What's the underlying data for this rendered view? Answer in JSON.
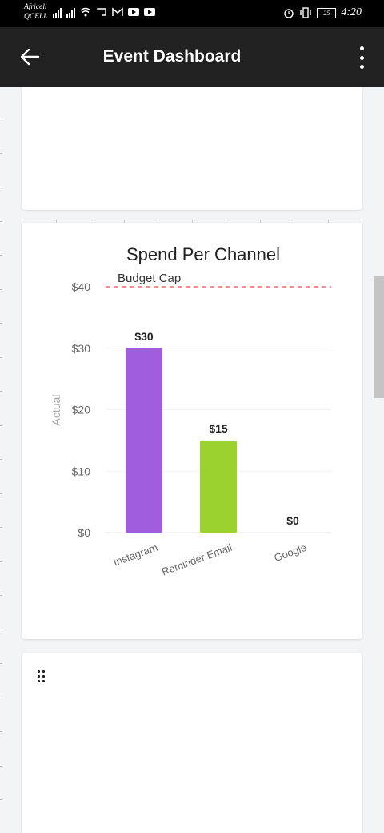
{
  "status_bar": {
    "carrier_line1": "Africell",
    "carrier_line2": "QCELL",
    "battery": "25",
    "time": "4:20"
  },
  "app_bar": {
    "title": "Event Dashboard",
    "back_icon": "arrow-left-icon",
    "more_icon": "more-vertical-icon"
  },
  "chart_data": {
    "type": "bar",
    "title": "Spend Per Channel",
    "ylabel": "Actual",
    "xlabel": "",
    "categories": [
      "Instagram",
      "Reminder Email",
      "Google"
    ],
    "values": [
      30,
      15,
      0
    ],
    "value_labels": [
      "$30",
      "$15",
      "$0"
    ],
    "bar_colors": [
      "#a05edc",
      "#9cd22f",
      "#cccccc"
    ],
    "ylim": [
      0,
      40
    ],
    "yticks": [
      0,
      10,
      20,
      30,
      40
    ],
    "ytick_labels": [
      "$0",
      "$10",
      "$20",
      "$30",
      "$40"
    ],
    "grid": true,
    "reference_line": {
      "label": "Budget Cap",
      "value": 40,
      "color": "#d9534f"
    }
  }
}
